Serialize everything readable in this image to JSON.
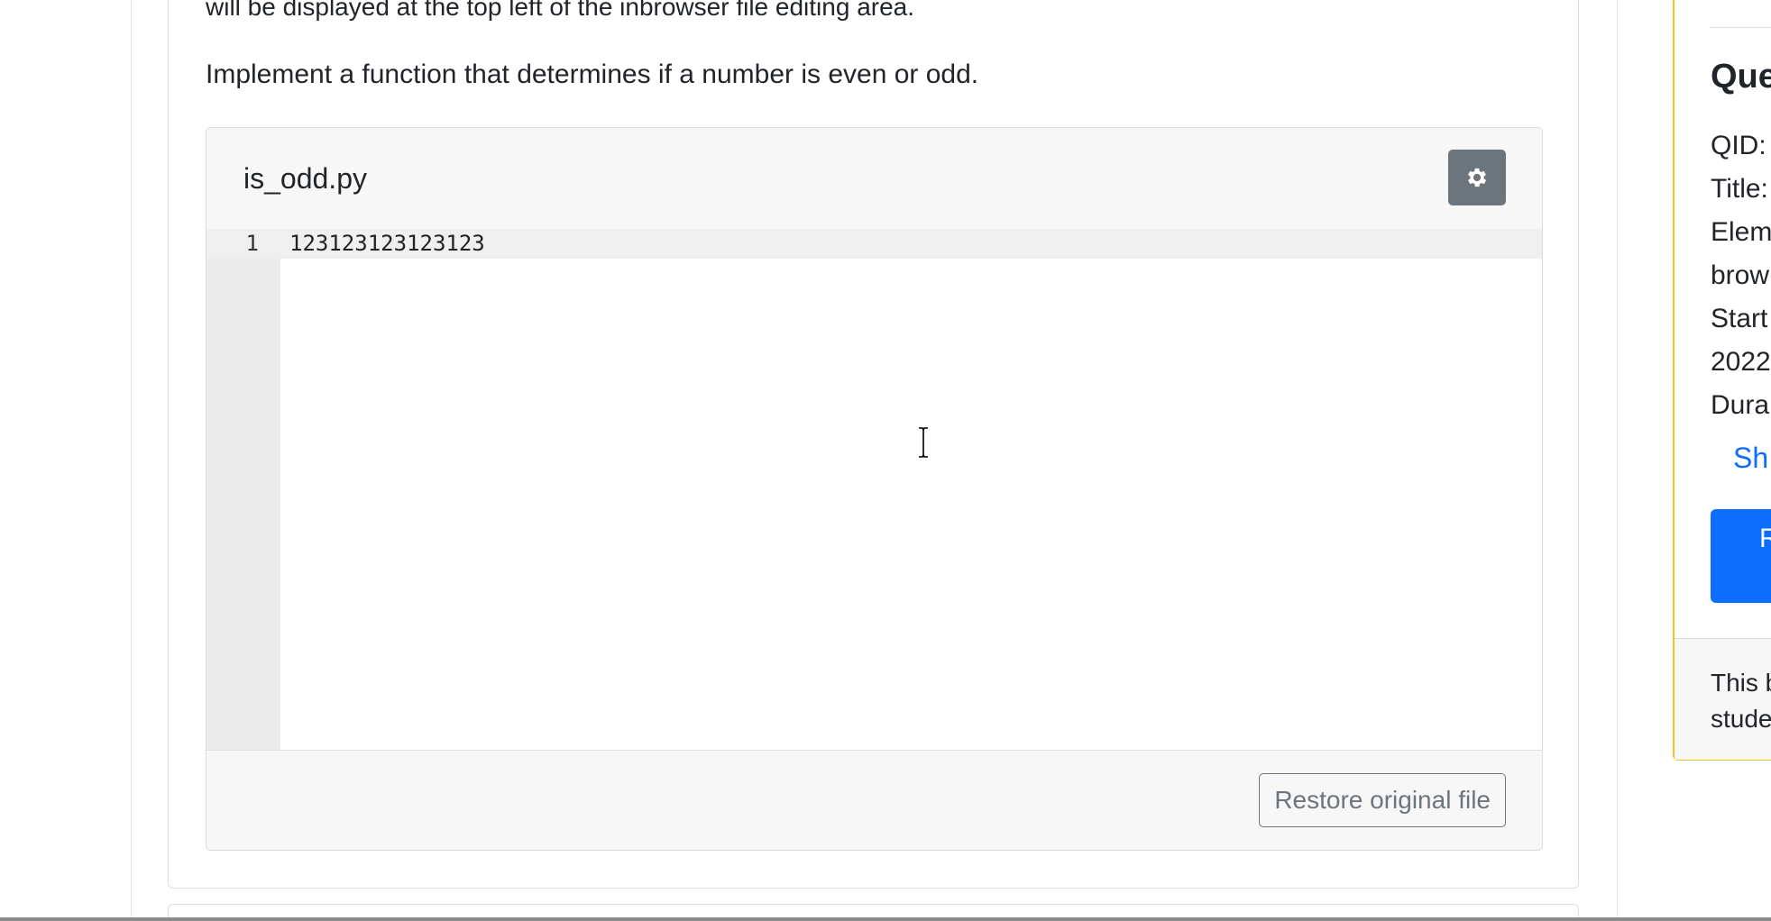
{
  "question": {
    "prev_text": "will be displayed at the top left of the inbrowser file editing area.",
    "prompt": "Implement a function that determines if a number is even or odd."
  },
  "file_editor": {
    "filename": "is_odd.py",
    "settings_icon": "gear-icon",
    "lines": [
      {
        "number": "1",
        "code": "123123123123123"
      }
    ],
    "restore_label": "Restore original file"
  },
  "sidebar": {
    "title": "Que",
    "rows": [
      "QID:",
      "Title:",
      "Elem",
      "brow",
      "Start",
      "2022",
      "Dura"
    ],
    "show_link": "Sh",
    "action_button": "R",
    "footer_lines": [
      "This b",
      "stude"
    ]
  },
  "colors": {
    "settings_button": "#6c757d",
    "primary": "#0d6efd",
    "sidebar_border": "#f0c419"
  }
}
